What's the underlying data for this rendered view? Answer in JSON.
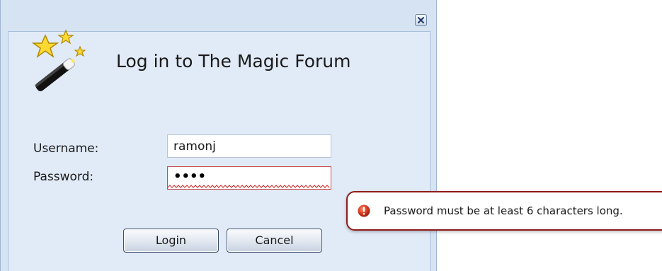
{
  "dialog": {
    "title": "Log in to The Magic Forum",
    "close_icon": "close-icon",
    "logo_icon": "magic-wand-icon"
  },
  "form": {
    "username_label": "Username:",
    "username_value": "ramonj",
    "password_label": "Password:",
    "password_value": "••••",
    "password_state": "invalid"
  },
  "buttons": {
    "login_label": "Login",
    "cancel_label": "Cancel"
  },
  "error_tooltip": {
    "icon": "error-icon",
    "message": "Password must be at least 6 characters long."
  },
  "colors": {
    "error": "#c0392b",
    "frame": "#d6e3f2",
    "panel": "#e1ebf7"
  }
}
